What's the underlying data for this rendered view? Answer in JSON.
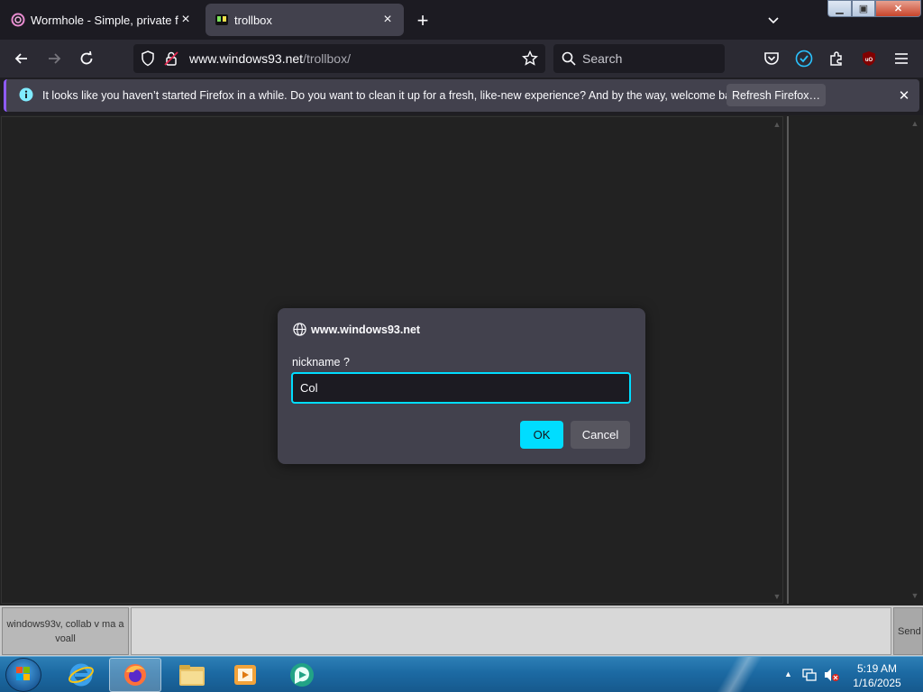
{
  "browser": {
    "tabs": [
      {
        "title": "Wormhole - Simple, private file",
        "active": false
      },
      {
        "title": "trollbox",
        "active": true
      }
    ],
    "url": {
      "host": "www.windows93.net",
      "path": "/trollbox/"
    },
    "search_placeholder": "Search"
  },
  "notification": {
    "text": "It looks like you haven’t started Firefox in a while. Do you want to clean it up for a fresh, like-new experience? And by the way, welcome back!",
    "button": "Refresh Firefox…"
  },
  "trollbox": {
    "nick_label": "windows93v, collab v ma a voall",
    "send_label": "Send"
  },
  "dialog": {
    "origin": "www.windows93.net",
    "message": "nickname ?",
    "input_value": "Col",
    "ok_label": "OK",
    "cancel_label": "Cancel"
  },
  "taskbar": {
    "time": "5:19 AM",
    "date": "1/16/2025"
  },
  "colors": {
    "accent": "#00ddff",
    "dialog_bg": "#42414d",
    "toolbar_bg": "#2b2a33"
  }
}
